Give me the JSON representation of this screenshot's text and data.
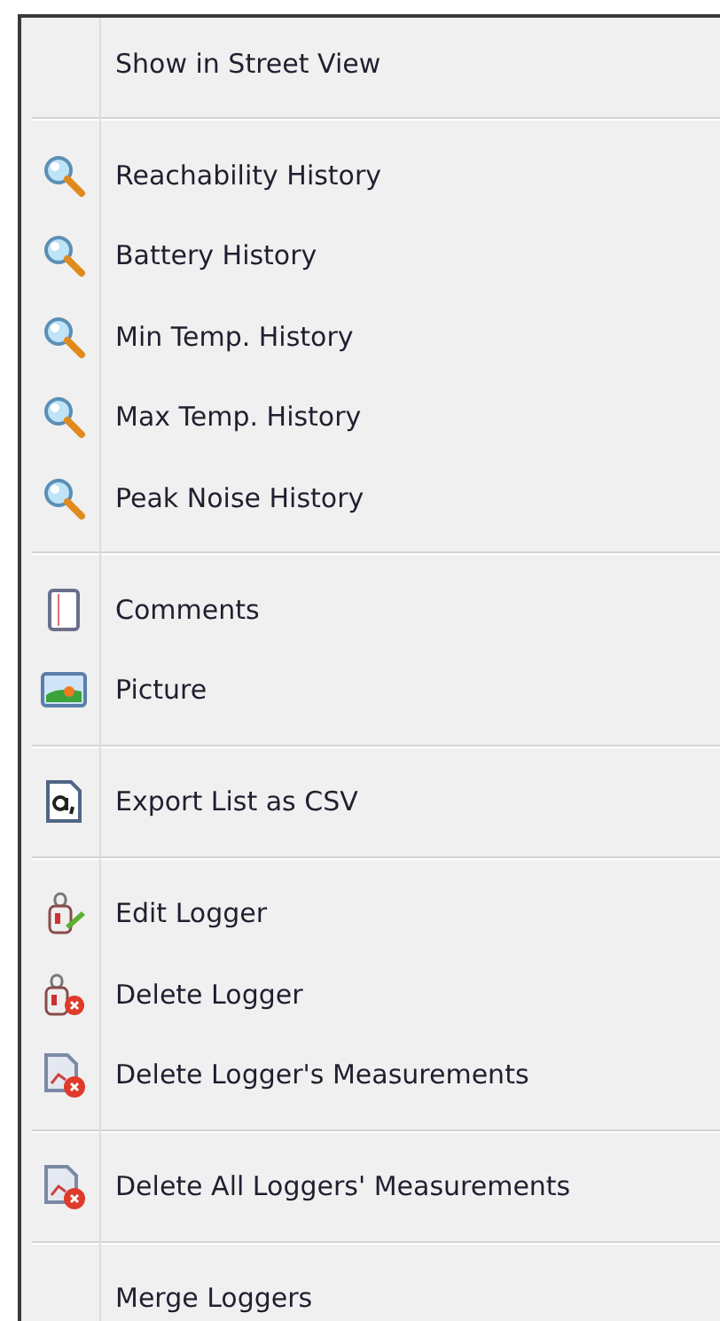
{
  "menu": {
    "groups": [
      {
        "items": [
          {
            "label": "Show in Street View",
            "kind": "none"
          }
        ]
      },
      {
        "items": [
          {
            "label": "Reachability History",
            "kind": "magnifier"
          },
          {
            "label": "Battery History",
            "kind": "magnifier"
          },
          {
            "label": "Min Temp. History",
            "kind": "magnifier"
          },
          {
            "label": "Max Temp. History",
            "kind": "magnifier"
          },
          {
            "label": "Peak Noise History",
            "kind": "magnifier"
          }
        ]
      },
      {
        "items": [
          {
            "label": "Comments",
            "kind": "notepad"
          },
          {
            "label": "Picture",
            "kind": "picture"
          }
        ]
      },
      {
        "items": [
          {
            "label": "Export List as CSV",
            "kind": "csv"
          }
        ]
      },
      {
        "items": [
          {
            "label": "Edit Logger",
            "kind": "edit-logger"
          },
          {
            "label": "Delete Logger",
            "kind": "delete-logger"
          },
          {
            "label": "Delete Logger's Measurements",
            "kind": "delete-measurements"
          }
        ]
      },
      {
        "items": [
          {
            "label": "Delete All Loggers' Measurements",
            "kind": "delete-measurements"
          }
        ]
      },
      {
        "items": [
          {
            "label": "Merge Loggers",
            "kind": "none"
          }
        ]
      }
    ]
  }
}
